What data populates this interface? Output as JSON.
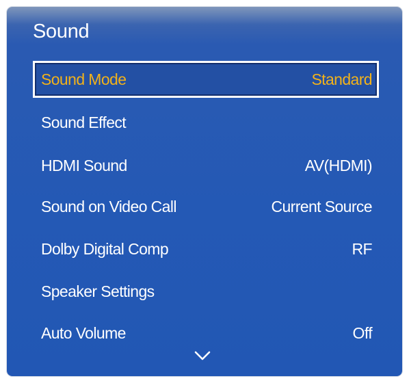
{
  "menu": {
    "title": "Sound",
    "items": [
      {
        "label": "Sound Mode",
        "value": "Standard"
      },
      {
        "label": "Sound Effect",
        "value": ""
      },
      {
        "label": "HDMI Sound",
        "value": "AV(HDMI)"
      },
      {
        "label": "Sound on Video Call",
        "value": "Current Source"
      },
      {
        "label": "Dolby Digital Comp",
        "value": "RF"
      },
      {
        "label": "Speaker Settings",
        "value": ""
      },
      {
        "label": "Auto Volume",
        "value": "Off"
      }
    ],
    "scroll_indicator_icon": "chevron-down-icon",
    "colors": {
      "panel": "#2459b5",
      "highlight_text": "#f2b21a",
      "text": "#ffffff"
    }
  }
}
